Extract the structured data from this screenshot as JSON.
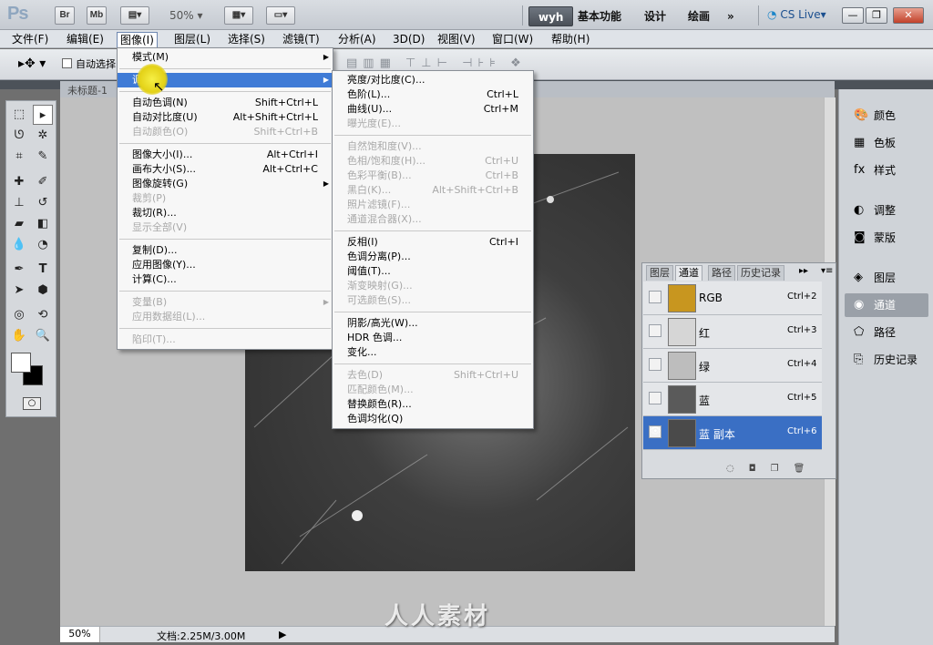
{
  "app": {
    "logo": "Ps",
    "bridge_btn": "Br",
    "minibridge_btn": "Mb",
    "zoom": "50%",
    "workspaces": [
      "wyh",
      "基本功能",
      "设计",
      "绘画"
    ],
    "more": "»",
    "cslive": "CS Live▾",
    "window_buttons": [
      "—",
      "❐",
      "✕"
    ]
  },
  "menubar": [
    "文件(F)",
    "编辑(E)",
    "图像(I)",
    "图层(L)",
    "选择(S)",
    "滤镜(T)",
    "分析(A)",
    "3D(D)",
    "视图(V)",
    "窗口(W)",
    "帮助(H)"
  ],
  "options": {
    "autoselect": "自动选择"
  },
  "document": {
    "tab_title": "未标题-1",
    "status_zoom": "50%",
    "status_info": "文档:2.25M/3.00M"
  },
  "image_menu": [
    {
      "label": "模式(M)",
      "submenu": true
    },
    {
      "sep": true
    },
    {
      "label": "调整(J)",
      "submenu": true,
      "highlight": true
    },
    {
      "sep": true
    },
    {
      "label": "自动色调(N)",
      "shortcut": "Shift+Ctrl+L"
    },
    {
      "label": "自动对比度(U)",
      "shortcut": "Alt+Shift+Ctrl+L"
    },
    {
      "label": "自动颜色(O)",
      "shortcut": "Shift+Ctrl+B",
      "disabled": true
    },
    {
      "sep": true
    },
    {
      "label": "图像大小(I)...",
      "shortcut": "Alt+Ctrl+I"
    },
    {
      "label": "画布大小(S)...",
      "shortcut": "Alt+Ctrl+C"
    },
    {
      "label": "图像旋转(G)",
      "submenu": true
    },
    {
      "label": "裁剪(P)",
      "disabled": true
    },
    {
      "label": "裁切(R)..."
    },
    {
      "label": "显示全部(V)",
      "disabled": true
    },
    {
      "sep": true
    },
    {
      "label": "复制(D)..."
    },
    {
      "label": "应用图像(Y)..."
    },
    {
      "label": "计算(C)..."
    },
    {
      "sep": true
    },
    {
      "label": "变量(B)",
      "submenu": true,
      "disabled": true
    },
    {
      "label": "应用数据组(L)...",
      "disabled": true
    },
    {
      "sep": true
    },
    {
      "label": "陷印(T)...",
      "disabled": true
    }
  ],
  "adjust_menu": [
    {
      "label": "亮度/对比度(C)..."
    },
    {
      "label": "色阶(L)...",
      "shortcut": "Ctrl+L"
    },
    {
      "label": "曲线(U)...",
      "shortcut": "Ctrl+M"
    },
    {
      "label": "曝光度(E)...",
      "disabled": true
    },
    {
      "sep": true
    },
    {
      "label": "自然饱和度(V)...",
      "disabled": true
    },
    {
      "label": "色相/饱和度(H)...",
      "shortcut": "Ctrl+U",
      "disabled": true
    },
    {
      "label": "色彩平衡(B)...",
      "shortcut": "Ctrl+B",
      "disabled": true
    },
    {
      "label": "黑白(K)...",
      "shortcut": "Alt+Shift+Ctrl+B",
      "disabled": true
    },
    {
      "label": "照片滤镜(F)...",
      "disabled": true
    },
    {
      "label": "通道混合器(X)...",
      "disabled": true
    },
    {
      "sep": true
    },
    {
      "label": "反相(I)",
      "shortcut": "Ctrl+I"
    },
    {
      "label": "色调分离(P)..."
    },
    {
      "label": "阈值(T)..."
    },
    {
      "label": "渐变映射(G)...",
      "disabled": true
    },
    {
      "label": "可选颜色(S)...",
      "disabled": true
    },
    {
      "sep": true
    },
    {
      "label": "阴影/高光(W)..."
    },
    {
      "label": "HDR 色调..."
    },
    {
      "label": "变化..."
    },
    {
      "sep": true
    },
    {
      "label": "去色(D)",
      "shortcut": "Shift+Ctrl+U",
      "disabled": true
    },
    {
      "label": "匹配颜色(M)...",
      "disabled": true
    },
    {
      "label": "替换颜色(R)..."
    },
    {
      "label": "色调均化(Q)"
    }
  ],
  "channels_panel": {
    "tabs": [
      "图层",
      "通道",
      "路径",
      "历史记录"
    ],
    "active_tab": "通道",
    "rows": [
      {
        "name": "RGB",
        "shortcut": "Ctrl+2",
        "thumb": "#c8961f",
        "visible": false
      },
      {
        "name": "红",
        "shortcut": "Ctrl+3",
        "thumb": "#d6d6d6",
        "visible": false
      },
      {
        "name": "绿",
        "shortcut": "Ctrl+4",
        "thumb": "#bdbdbd",
        "visible": false
      },
      {
        "name": "蓝",
        "shortcut": "Ctrl+5",
        "thumb": "#5a5a5a",
        "visible": false
      },
      {
        "name": "蓝 副本",
        "shortcut": "Ctrl+6",
        "thumb": "#4a4a4a",
        "visible": true,
        "selected": true
      }
    ]
  },
  "right_dock": [
    {
      "label": "颜色",
      "icon": "palette-icon"
    },
    {
      "label": "色板",
      "icon": "swatches-icon"
    },
    {
      "label": "样式",
      "icon": "fx-icon"
    },
    {
      "label": "调整",
      "icon": "adjust-icon"
    },
    {
      "label": "蒙版",
      "icon": "mask-icon"
    },
    {
      "label": "图层",
      "icon": "layers-icon"
    },
    {
      "label": "通道",
      "icon": "channels-icon"
    },
    {
      "label": "路径",
      "icon": "paths-icon"
    },
    {
      "label": "历史记录",
      "icon": "history-icon"
    }
  ],
  "watermark": "人人素材",
  "colors": {
    "highlight": "#3f7bd6",
    "selected_row": "#3a6fc4"
  }
}
